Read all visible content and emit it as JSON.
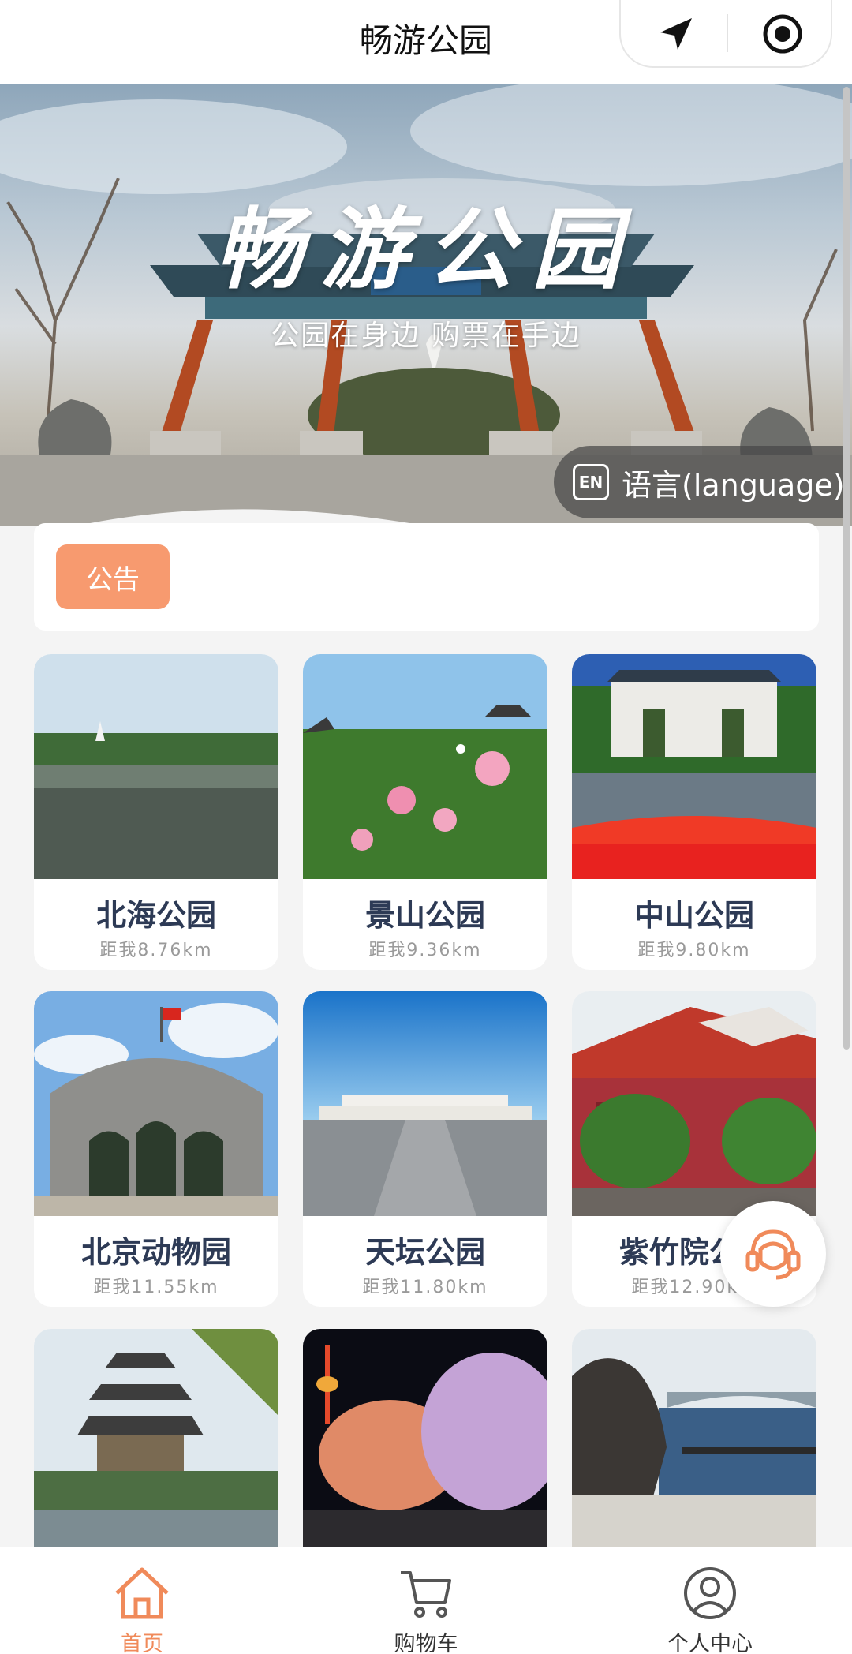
{
  "header": {
    "title": "畅游公园"
  },
  "banner": {
    "title": "畅游公园",
    "subtitle": "公园在身边 购票在手边",
    "language_label": "语言(language)",
    "language_icon_text": "EN"
  },
  "notice": {
    "badge": "公告"
  },
  "parks": [
    {
      "name": "北海公园",
      "distance": "距我8.76km"
    },
    {
      "name": "景山公园",
      "distance": "距我9.36km"
    },
    {
      "name": "中山公园",
      "distance": "距我9.80km"
    },
    {
      "name": "北京动物园",
      "distance": "距我11.55km"
    },
    {
      "name": "天坛公园",
      "distance": "距我11.80km"
    },
    {
      "name": "紫竹院公园",
      "distance": "距我12.90km"
    }
  ],
  "tabs": [
    {
      "label": "首页",
      "icon": "home-icon"
    },
    {
      "label": "购物车",
      "icon": "cart-icon"
    },
    {
      "label": "个人中心",
      "icon": "user-icon"
    }
  ],
  "colors": {
    "accent": "#f08a5a",
    "notice_badge": "#f79a6f",
    "park_name": "#2d3a55"
  }
}
